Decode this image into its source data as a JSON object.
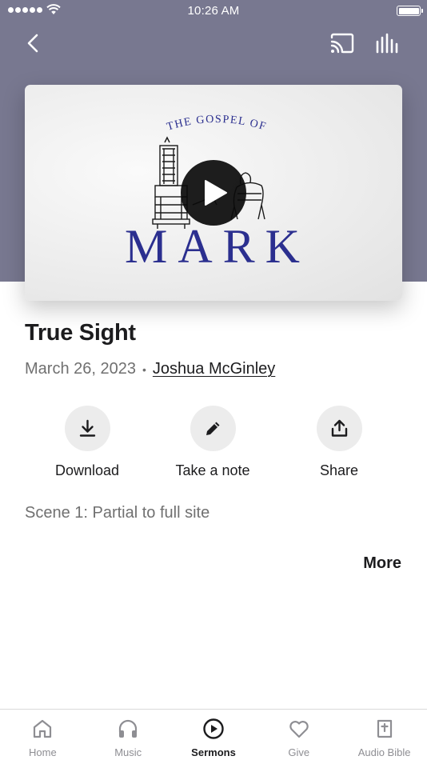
{
  "status_bar": {
    "time": "10:26 AM"
  },
  "header": {
    "back_icon": "chevron-left-icon",
    "cast_icon": "cast-icon",
    "stats_icon": "bar-chart-icon",
    "background_color": "#787890"
  },
  "artwork": {
    "subtitle": "THE GOSPEL OF",
    "title": "MARK",
    "title_color": "#2b2f8f",
    "play_icon": "play-icon"
  },
  "sermon": {
    "title": "True Sight",
    "date": "March 26, 2023",
    "separator": "•",
    "speaker": "Joshua McGinley",
    "description": "Scene 1: Partial to full site",
    "more_label": "More"
  },
  "actions": [
    {
      "label": "Download",
      "icon": "download-icon"
    },
    {
      "label": "Take a note",
      "icon": "pencil-icon"
    },
    {
      "label": "Share",
      "icon": "share-icon"
    }
  ],
  "tabs": [
    {
      "label": "Home",
      "icon": "home-icon",
      "active": false
    },
    {
      "label": "Music",
      "icon": "headphones-icon",
      "active": false
    },
    {
      "label": "Sermons",
      "icon": "play-circle-icon",
      "active": true
    },
    {
      "label": "Give",
      "icon": "heart-icon",
      "active": false
    },
    {
      "label": "Audio Bible",
      "icon": "bible-icon",
      "active": false
    }
  ]
}
